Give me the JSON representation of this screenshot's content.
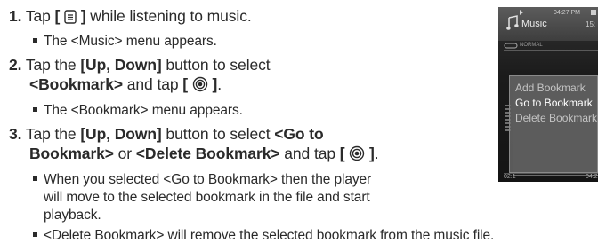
{
  "steps": [
    {
      "number": "1.",
      "text_before": "Tap ",
      "button_open": "[",
      "button_close": "]",
      "text_after": " while listening to music.",
      "button_icon": "menu-icon",
      "bullets": [
        "The <Music> menu appears."
      ]
    },
    {
      "number": "2.",
      "text_a": "Tap the ",
      "keys": "[Up, Down]",
      "text_b": " button to select",
      "target": "<Bookmark>",
      "text_c": " and tap ",
      "button_open": "[",
      "button_close": "]",
      "end": ".",
      "button_icon": "select-icon",
      "bullets": [
        "The <Bookmark> menu appears."
      ]
    },
    {
      "number": "3.",
      "text_a": "Tap the ",
      "keys": "[Up, Down]",
      "text_b": " button to select ",
      "target_a": "<Go to",
      "target_a2": "Bookmark>",
      "or": " or ",
      "target_b": "<Delete Bookmark>",
      "text_c": " and tap ",
      "button_open": "[",
      "button_close": "]",
      "end": ".",
      "button_icon": "select-icon",
      "bullets": [
        "When you selected <Go to Bookmark> then the player",
        "will move to the selected bookmark in the file and start",
        "playback.",
        "<Delete Bookmark> will remove the selected bookmark from the music file."
      ]
    }
  ],
  "device": {
    "title": "Music",
    "clock": "04:27 PM",
    "elapsed": "15:",
    "repeat_mode": "NORMAL",
    "menu_items": [
      "Add Bookmark",
      "Go to Bookmark",
      "Delete Bookmark"
    ],
    "selected_item": "Go to Bookmark",
    "time_start": "02:1",
    "time_end": "04:2"
  },
  "colors": {
    "text": "#2a2a2a",
    "screen_bg": "#141414",
    "menu_bg": "#6e6e6e",
    "menu_text": "#c4c4c4",
    "menu_text_selected": "#ffffff"
  }
}
